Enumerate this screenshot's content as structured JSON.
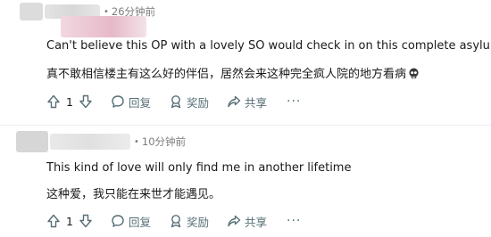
{
  "comments": [
    {
      "time": "26分钟前",
      "separator": "•",
      "line1": "Can't believe this OP with a lovely SO would check in on this complete asylum",
      "line2": "真不敢相信楼主有这么好的伴侣，居然会来这种完全疯人院的地方看病",
      "emoji": "skull-icon",
      "votes": "1",
      "reply_label": "回复",
      "award_label": "奖励",
      "share_label": "共享",
      "more_label": "···"
    },
    {
      "time": "10分钟前",
      "separator": "•",
      "line1": "This kind of love will only find me in another lifetime",
      "line2": "这种爱，我只能在来世才能遇见。",
      "votes": "1",
      "reply_label": "回复",
      "award_label": "奖励",
      "share_label": "共享",
      "more_label": "···"
    }
  ],
  "colors": {
    "text": "#1a1a1b",
    "meta": "#7c7c7c",
    "action": "#576f76",
    "divider": "#edeff1"
  }
}
